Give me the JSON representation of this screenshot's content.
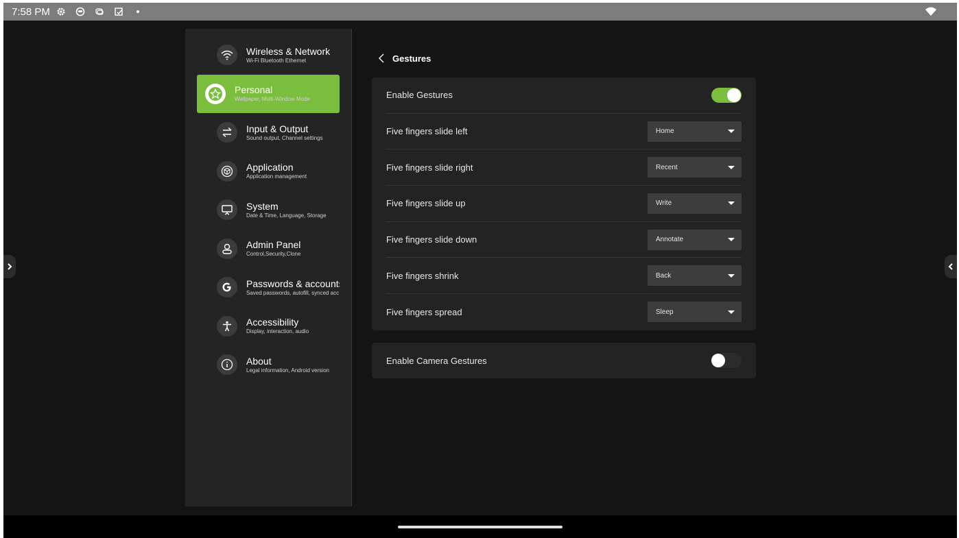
{
  "status_bar": {
    "time": "7:58 PM",
    "icons": [
      "gear-icon",
      "assistant-icon",
      "message-icon",
      "note-icon",
      "dot-icon"
    ],
    "wifi_icon": "wifi-icon"
  },
  "sidebar": {
    "items": [
      {
        "title": "Wireless & Network",
        "subtitle": "Wi-Fi Bluetooth Ethernet",
        "icon": "wifi-icon",
        "active": false
      },
      {
        "title": "Personal",
        "subtitle": "Wallpaper, Multi-Window Mode",
        "icon": "star-icon",
        "active": true
      },
      {
        "title": "Input & Output",
        "subtitle": "Sound output, Channel settings",
        "icon": "swap-icon",
        "active": false
      },
      {
        "title": "Application",
        "subtitle": "Application management",
        "icon": "cube-icon",
        "active": false
      },
      {
        "title": "System",
        "subtitle": "Date & Time, Language, Storage",
        "icon": "presentation-icon",
        "active": false
      },
      {
        "title": "Admin Panel",
        "subtitle": "Control,Security,Clone",
        "icon": "person-icon",
        "active": false
      },
      {
        "title": "Passwords & accounts",
        "subtitle": "Saved passwords, autofill, synced acc",
        "icon": "google-icon",
        "active": false
      },
      {
        "title": "Accessibility",
        "subtitle": "Display, interaction, audio",
        "icon": "accessibility-icon",
        "active": false
      },
      {
        "title": "About",
        "subtitle": "Legal information, Android version",
        "icon": "info-icon",
        "active": false
      }
    ]
  },
  "header": {
    "title": "Gestures"
  },
  "gestures": {
    "enable_label": "Enable Gestures",
    "enable_on": true,
    "rows": [
      {
        "label": "Five fingers slide left",
        "value": "Home"
      },
      {
        "label": "Five fingers slide right",
        "value": "Recent"
      },
      {
        "label": "Five fingers slide up",
        "value": "Write"
      },
      {
        "label": "Five fingers slide down",
        "value": "Annotate"
      },
      {
        "label": "Five fingers shrink",
        "value": "Back"
      },
      {
        "label": "Five fingers spread",
        "value": "Sleep"
      }
    ]
  },
  "camera": {
    "label": "Enable Camera Gestures",
    "on": false
  },
  "colors": {
    "accent": "#7bbd3c",
    "background": "#141414",
    "card": "#232323",
    "sidebar": "#242424",
    "select": "#3d3d3d",
    "status_bar": "#7c7c7c"
  }
}
